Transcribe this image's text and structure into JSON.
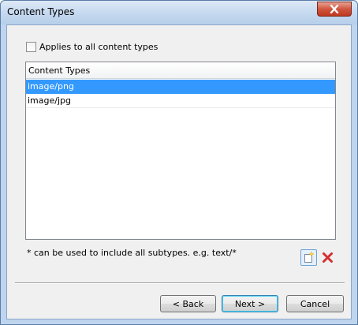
{
  "window": {
    "title": "Content Types"
  },
  "options": {
    "applies_all_label": "Applies to all content types",
    "applies_all_checked": false
  },
  "table": {
    "header": "Content Types",
    "rows": [
      {
        "value": "image/png",
        "selected": true
      },
      {
        "value": "image/jpg",
        "selected": false
      }
    ]
  },
  "hint": "* can be used to include all subtypes. e.g. text/*",
  "toolbar": {
    "add_icon": "new-item-icon",
    "delete_icon": "delete-x-icon"
  },
  "buttons": {
    "back": "< Back",
    "next": "Next >",
    "cancel": "Cancel"
  },
  "colors": {
    "selection": "#3399ff",
    "delete_red": "#d32f2f"
  }
}
